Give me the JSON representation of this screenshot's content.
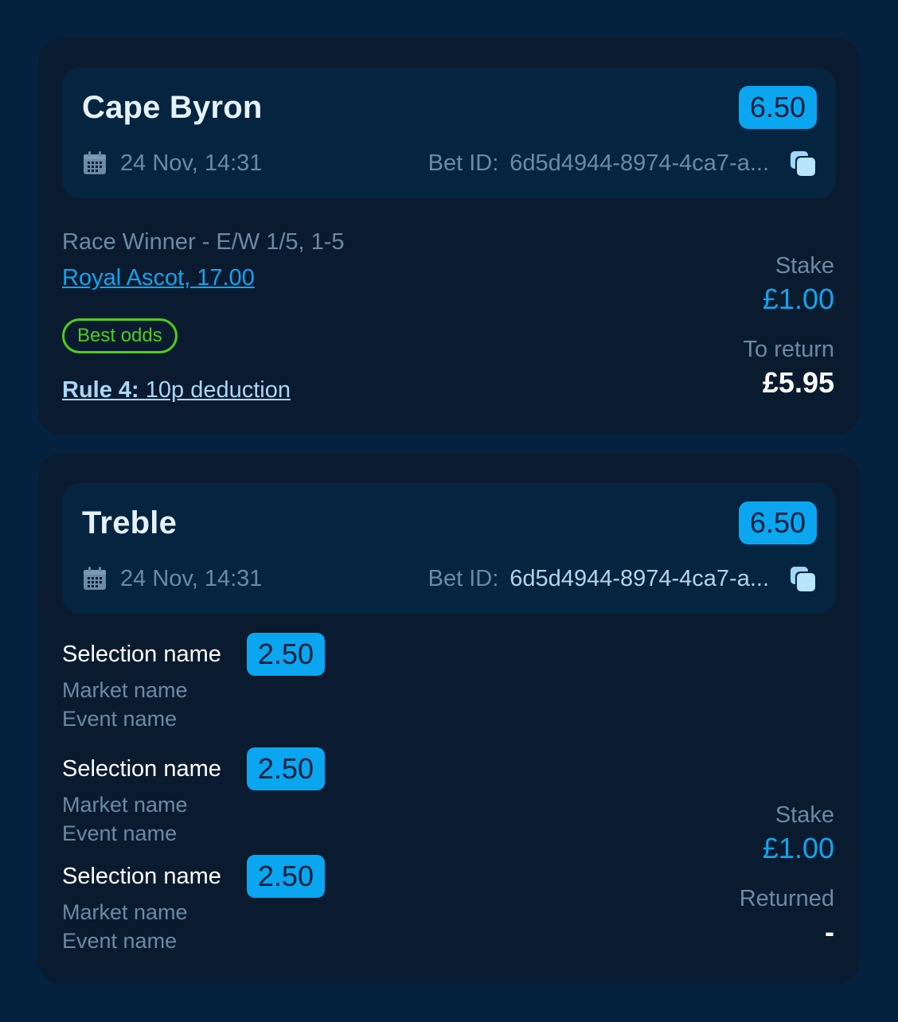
{
  "bets": [
    {
      "title": "Cape Byron",
      "odds": "6.50",
      "date": "24 Nov, 14:31",
      "bet_id_label": "Bet ID:",
      "bet_id": "6d5d4944-8974-4ca7-a...",
      "market": "Race Winner - E/W 1/5, 1-5",
      "event": "Royal Ascot, 17.00",
      "badge": "Best odds",
      "rule_label": "Rule 4:",
      "rule_text": "10p deduction",
      "stake_label": "Stake",
      "stake": "£1.00",
      "return_label": "To return",
      "return_value": "£5.95"
    },
    {
      "title": "Treble",
      "odds": "6.50",
      "date": "24 Nov, 14:31",
      "bet_id_label": "Bet ID:",
      "bet_id": "6d5d4944-8974-4ca7-a...",
      "selections": [
        {
          "name": "Selection name",
          "odds": "2.50",
          "market": "Market name",
          "event": "Event name"
        },
        {
          "name": "Selection name",
          "odds": "2.50",
          "market": "Market name",
          "event": "Event name"
        },
        {
          "name": "Selection name",
          "odds": "2.50",
          "market": "Market name",
          "event": "Event name"
        }
      ],
      "stake_label": "Stake",
      "stake": "£1.00",
      "return_label": "Returned",
      "return_value": "-"
    }
  ],
  "colors": {
    "page_bg": "#04213f",
    "card_bg": "#0b1b2f",
    "header_bg": "#05243f",
    "accent": "#0aa6f0",
    "best_odds": "#4fcd1f"
  },
  "icons": {
    "date": "calendar-icon",
    "copy": "copy-icon"
  }
}
